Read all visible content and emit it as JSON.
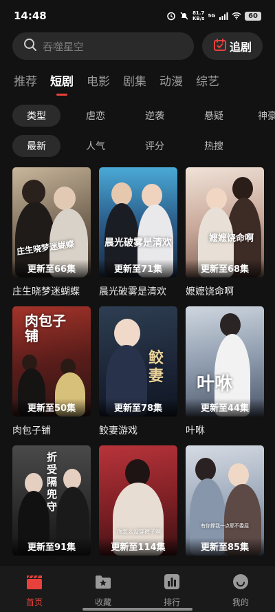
{
  "status": {
    "time": "14:48",
    "net_speed_value": "81.7",
    "net_speed_unit": "KB/s",
    "signal": "5G",
    "battery": "60"
  },
  "search": {
    "placeholder": "吞噬星空"
  },
  "follow_label": "追剧",
  "main_tabs": [
    "推荐",
    "短剧",
    "电影",
    "剧集",
    "动漫",
    "综艺"
  ],
  "active_main_tab": "短剧",
  "filter_row1": [
    "类型",
    "虐恋",
    "逆袭",
    "悬疑",
    "神豪"
  ],
  "filter_row2": [
    "最新",
    "人气",
    "评分",
    "热搜"
  ],
  "dramas": [
    {
      "title": "庄生晓梦迷蝴蝶",
      "poster_text": "庄生晓梦迷蝴蝶",
      "update": "更新至66集"
    },
    {
      "title": "晨光破雾是清欢",
      "poster_text": "晨光破雾是清欢",
      "update": "更新至71集"
    },
    {
      "title": "嬷嬷饶命啊",
      "poster_text": "嬷嬷饶命啊",
      "update": "更新至68集"
    },
    {
      "title": "肉包子铺",
      "poster_text": "肉包子铺",
      "update": "更新至50集"
    },
    {
      "title": "鲛妻游戏",
      "poster_text": "鲛妻",
      "update": "更新至78集"
    },
    {
      "title": "叶咻",
      "poster_text": "叶咻",
      "update": "更新至44集"
    },
    {
      "title": "",
      "poster_text": "折受隔兜守",
      "update": "更新至91集"
    },
    {
      "title": "",
      "poster_text": "你怎么没穿裤子啊",
      "update": "更新至114集"
    },
    {
      "title": "",
      "poster_text": "有你撑我一点耶不委屈",
      "update": "更新至85集"
    }
  ],
  "nav": [
    "首页",
    "收藏",
    "排行",
    "我的"
  ],
  "colors": {
    "accent": "#e8413b",
    "background": "#121212"
  }
}
